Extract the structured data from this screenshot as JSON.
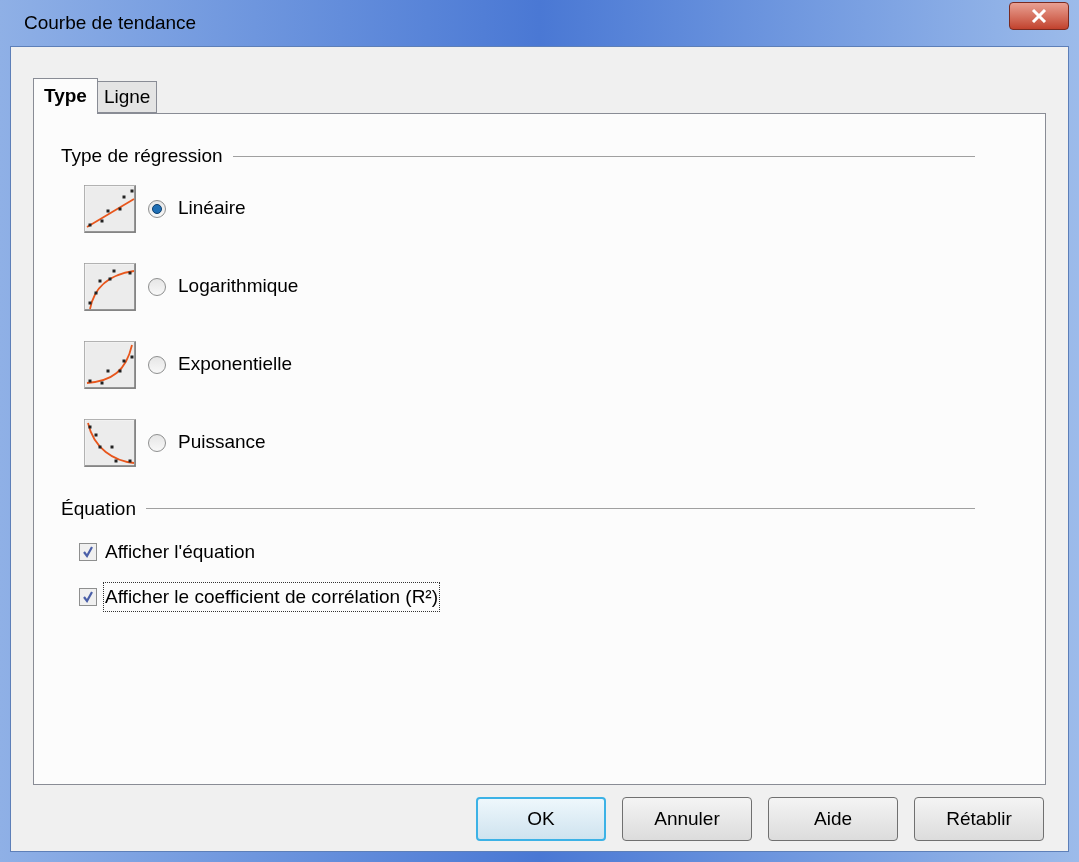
{
  "window": {
    "title": "Courbe de tendance"
  },
  "tabs": [
    {
      "label": "Type",
      "selected": true
    },
    {
      "label": "Ligne",
      "selected": false
    }
  ],
  "regression": {
    "title": "Type de régression",
    "options": [
      {
        "label": "Linéaire",
        "kind": "linear",
        "selected": true
      },
      {
        "label": "Logarithmique",
        "kind": "logarithmic",
        "selected": false
      },
      {
        "label": "Exponentielle",
        "kind": "exponential",
        "selected": false
      },
      {
        "label": "Puissance",
        "kind": "power",
        "selected": false
      }
    ]
  },
  "equation": {
    "title": "Équation",
    "options": [
      {
        "label": "Afficher l'équation",
        "checked": true,
        "focused": false
      },
      {
        "label": "Afficher le coefficient de corrélation (R²)",
        "checked": true,
        "focused": true
      }
    ]
  },
  "buttons": [
    {
      "label": "OK",
      "default": true
    },
    {
      "label": "Annuler",
      "default": false
    },
    {
      "label": "Aide",
      "default": false
    },
    {
      "label": "Rétablir",
      "default": false
    }
  ]
}
